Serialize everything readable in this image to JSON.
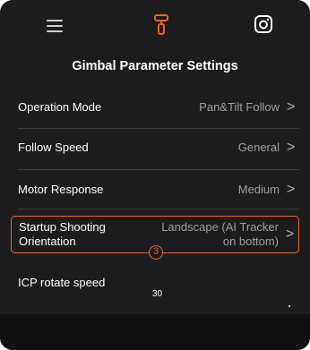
{
  "colors": {
    "accent": "#e8632b",
    "background": "#1c1c1e",
    "text": "#ffffff",
    "muted": "#9e9e9e"
  },
  "header": {
    "left_icon": "menu-icon",
    "center_icon": "gimbal-icon",
    "right_icon": "instagram-icon"
  },
  "page_title": "Gimbal Parameter Settings",
  "settings": [
    {
      "label": "Operation Mode",
      "value": "Pan&Tilt Follow"
    },
    {
      "label": "Follow Speed",
      "value": "General"
    },
    {
      "label": "Motor Response",
      "value": "Medium"
    },
    {
      "label_line1": "Startup Shooting",
      "label_line2": "Orientation",
      "value_line1": "Landscape (AI Tracker",
      "value_line2": "on bottom)"
    }
  ],
  "chevron": ">",
  "callout_badge": "3",
  "icp": {
    "label": "ICP rotate speed",
    "value": "30"
  }
}
